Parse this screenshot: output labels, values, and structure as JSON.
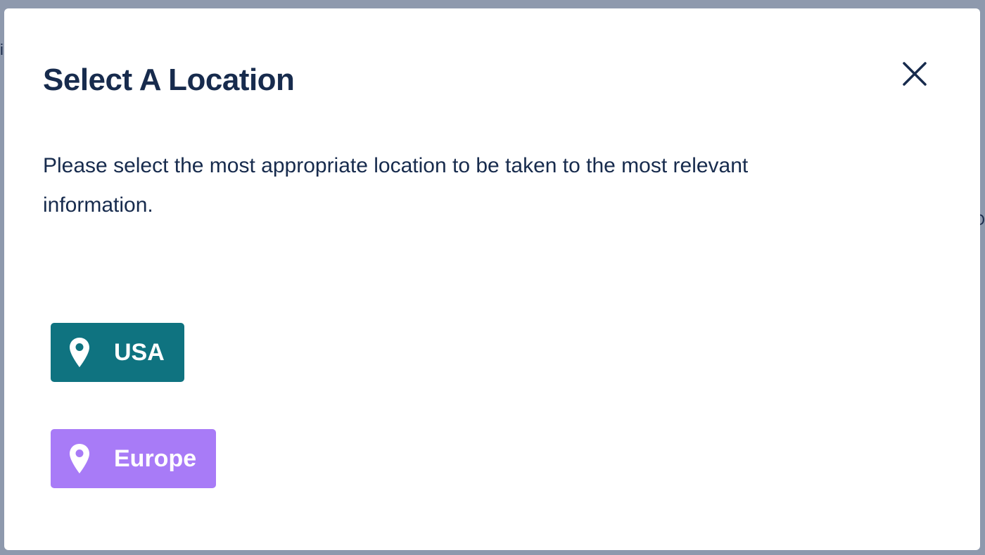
{
  "backdrop": {
    "left_glyph": "i",
    "right_glyph": "O"
  },
  "modal": {
    "title": "Select A Location",
    "description": "Please select the most appropriate location to be taken to the most relevant information.",
    "close_icon": "close-icon"
  },
  "locations": [
    {
      "label": "USA",
      "icon": "map-pin-icon",
      "color": "#0f7380"
    },
    {
      "label": "Europe",
      "icon": "map-pin-icon",
      "color": "#a87bf7"
    }
  ],
  "colors": {
    "title_text": "#172b4d",
    "backdrop": "#8e99ad"
  }
}
